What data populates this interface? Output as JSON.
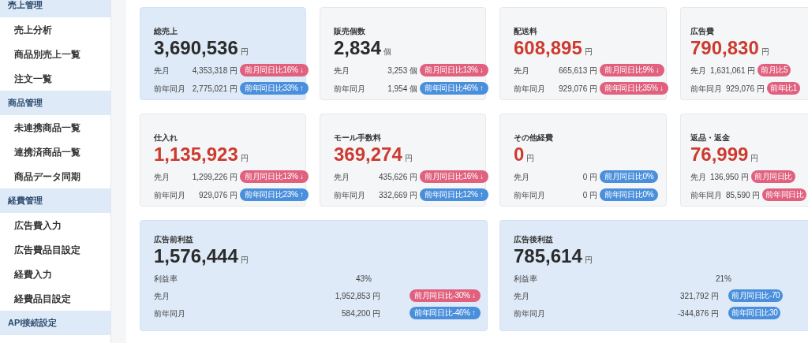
{
  "sidebar": {
    "sections": [
      {
        "title": "売上管理",
        "items": [
          "売上分析",
          "商品別売上一覧",
          "注文一覧"
        ]
      },
      {
        "title": "商品管理",
        "items": [
          "未連携商品一覧",
          "連携済商品一覧",
          "商品データ同期"
        ]
      },
      {
        "title": "経費管理",
        "items": [
          "広告費入力",
          "広告費品目設定",
          "経費入力",
          "経費品目設定"
        ]
      },
      {
        "title": "API接続設定"
      }
    ]
  },
  "cards": [
    {
      "kind": "income",
      "title": "総売上",
      "value": "3,690,536",
      "unit": "円",
      "rows": [
        {
          "label": "先月",
          "value": "4,353,318 円",
          "badge": "前月同日比16% ↓",
          "color": "#e0607e"
        },
        {
          "label": "前年同月",
          "value": "2,775,021 円",
          "badge": "前年同日比33% ↑",
          "color": "#4a8fdc"
        }
      ]
    },
    {
      "kind": "metric",
      "title": "販売個数",
      "value": "2,834",
      "unit": "個",
      "rows": [
        {
          "label": "先月",
          "value": "3,253 個",
          "badge": "前月同日比13% ↓",
          "color": "#e0607e"
        },
        {
          "label": "前年同月",
          "value": "1,954 個",
          "badge": "前年同日比46% ↑",
          "color": "#4a8fdc"
        }
      ]
    },
    {
      "kind": "cost",
      "title": "配送料",
      "value": "608,895",
      "unit": "円",
      "rows": [
        {
          "label": "先月",
          "value": "665,613 円",
          "badge": "前月同日比9% ↓",
          "color": "#e0607e"
        },
        {
          "label": "前年同月",
          "value": "929,076 円",
          "badge": "前年同日比35% ↓",
          "color": "#e0607e"
        }
      ]
    },
    {
      "kind": "cost",
      "title": "広告費",
      "value": "790,830",
      "unit": "円",
      "rows": [
        {
          "label": "先月",
          "value": "1,631,061 円",
          "badge": "前月比5",
          "color": "#e0607e"
        },
        {
          "label": "前年同月",
          "value": "929,076 円",
          "badge": "前年比1",
          "color": "#e0607e"
        }
      ]
    },
    {
      "kind": "cost",
      "title": "仕入れ",
      "value": "1,135,923",
      "unit": "円",
      "rows": [
        {
          "label": "先月",
          "value": "1,299,226 円",
          "badge": "前月同日比13% ↓",
          "color": "#e0607e"
        },
        {
          "label": "前年同月",
          "value": "929,076 円",
          "badge": "前年同日比23% ↑",
          "color": "#4a8fdc"
        }
      ]
    },
    {
      "kind": "cost",
      "title": "モール手数料",
      "value": "369,274",
      "unit": "円",
      "rows": [
        {
          "label": "先月",
          "value": "435,626 円",
          "badge": "前月同日比16% ↓",
          "color": "#e0607e"
        },
        {
          "label": "前年同月",
          "value": "332,669 円",
          "badge": "前年同日比12% ↑",
          "color": "#4a8fdc"
        }
      ]
    },
    {
      "kind": "cost",
      "title": "その他経費",
      "value": "0",
      "unit": "円",
      "rows": [
        {
          "label": "先月",
          "value": "0 円",
          "badge": "前月同日比0%",
          "color": "#4a8fdc"
        },
        {
          "label": "前年同月",
          "value": "0 円",
          "badge": "前年同日比0%",
          "color": "#4a8fdc"
        }
      ]
    },
    {
      "kind": "cost",
      "title": "返品・返金",
      "value": "76,999",
      "unit": "円",
      "rows": [
        {
          "label": "先月",
          "value": "136,950 円",
          "badge": "前月同日比",
          "color": "#e0607e"
        },
        {
          "label": "前年同月",
          "value": "85,590 円",
          "badge": "前年同日比",
          "color": "#e0607e"
        }
      ]
    }
  ],
  "profits": [
    {
      "title": "広告前利益",
      "value": "1,576,444",
      "unit": "円",
      "rate_label": "利益率",
      "rate": "43%",
      "rows": [
        {
          "label": "先月",
          "value": "1,952,853 円",
          "badge": "前月同日比-30% ↓",
          "color": "#e0607e"
        },
        {
          "label": "前年同月",
          "value": "584,200 円",
          "badge": "前年同日比-46% ↑",
          "color": "#4a8fdc"
        }
      ]
    },
    {
      "title": "広告後利益",
      "value": "785,614",
      "unit": "円",
      "rate_label": "利益率",
      "rate": "21%",
      "rows": [
        {
          "label": "先月",
          "value": "321,792 円",
          "badge": "前月同日比-70",
          "color": "#4a8fdc"
        },
        {
          "label": "前年同月",
          "value": "-344,876 円",
          "badge": "前年同日比30",
          "color": "#4a8fdc"
        }
      ]
    }
  ]
}
